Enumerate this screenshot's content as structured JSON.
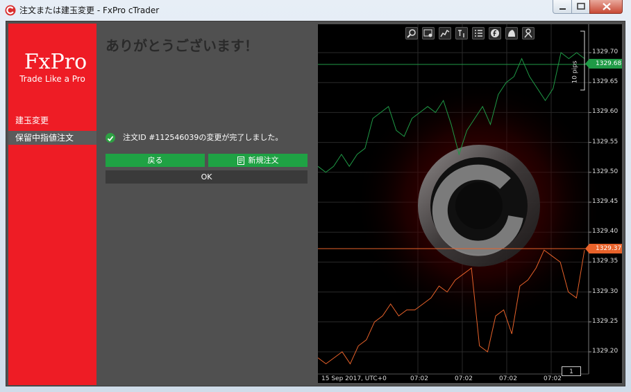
{
  "window": {
    "title": "注文または建玉変更 - FxPro cTrader"
  },
  "sidebar": {
    "logo": "FxPro",
    "tagline": "Trade Like a Pro",
    "items": [
      {
        "label": "建玉変更"
      },
      {
        "label": "保留中指値注文"
      }
    ]
  },
  "main": {
    "heading": "ありがとうございます！",
    "status_message": "注文ID #112546039の変更が完了しました。",
    "back_label": "戻る",
    "new_order_label": "新規注文",
    "ok_label": "OK"
  },
  "chart": {
    "price_ask": "1329.68",
    "price_bid": "1329.37",
    "pips_label": "10 pips",
    "y_ticks": [
      "1329.70",
      "1329.65",
      "1329.60",
      "1329.55",
      "1329.50",
      "1329.45",
      "1329.40",
      "1329.35",
      "1329.30",
      "1329.25",
      "1329.20"
    ],
    "x_date_label": "15 Sep 2017, UTC+0",
    "x_ticks": [
      "07:02",
      "07:02",
      "07:02",
      "07:02"
    ],
    "zoom_level": "1",
    "colors": {
      "ask": "#1f9a46",
      "bid": "#e8622a"
    }
  },
  "chart_data": {
    "type": "line",
    "ylim": [
      1329.17,
      1329.72
    ],
    "series": [
      {
        "values": [
          1329.51,
          1329.5,
          1329.51,
          1329.53,
          1329.51,
          1329.53,
          1329.54,
          1329.59,
          1329.6,
          1329.61,
          1329.57,
          1329.56,
          1329.59,
          1329.6,
          1329.61,
          1329.6,
          1329.62,
          1329.58,
          1329.53,
          1329.57,
          1329.59,
          1329.61,
          1329.58,
          1329.63,
          1329.65,
          1329.66,
          1329.69,
          1329.66,
          1329.64,
          1329.62,
          1329.64,
          1329.7,
          1329.69,
          1329.7,
          1329.69
        ]
      },
      {
        "values": [
          1329.19,
          1329.18,
          1329.19,
          1329.2,
          1329.18,
          1329.21,
          1329.22,
          1329.25,
          1329.26,
          1329.28,
          1329.26,
          1329.27,
          1329.27,
          1329.28,
          1329.29,
          1329.31,
          1329.3,
          1329.32,
          1329.33,
          1329.34,
          1329.21,
          1329.2,
          1329.26,
          1329.27,
          1329.23,
          1329.31,
          1329.32,
          1329.34,
          1329.37,
          1329.36,
          1329.35,
          1329.3,
          1329.29,
          1329.37
        ]
      }
    ]
  }
}
